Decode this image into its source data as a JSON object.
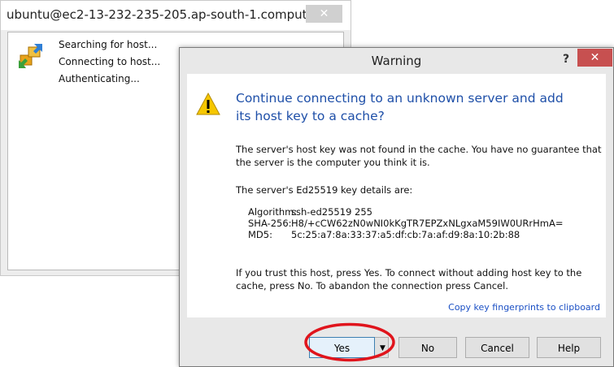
{
  "background_window": {
    "title": "ubuntu@ec2-13-232-235-205.ap-south-1.comput...",
    "close_glyph": "✕",
    "icon": "network-connect-icon",
    "status_lines": [
      "Searching for host...",
      "Connecting to host...",
      "Authenticating..."
    ]
  },
  "dialog": {
    "title": "Warning",
    "help_glyph": "?",
    "close_glyph": "✕",
    "icon": "warning-icon",
    "heading": "Continue connecting to an unknown server and add its host key to a cache?",
    "paragraph1": "The server's host key was not found in the cache. You have no guarantee that the server is the computer you think it is.",
    "paragraph2": "The server's Ed25519 key details are:",
    "key_details": [
      {
        "label": "Algorithm:",
        "value": "ssh-ed25519 255"
      },
      {
        "label": "SHA-256:",
        "value": "H8/+cCW62zN0wNI0kKgTR7EPZxNLgxaM59IW0URrHmA="
      },
      {
        "label": "MD5:",
        "value": "5c:25:a7:8a:33:37:a5:df:cb:7a:af:d9:8a:10:2b:88"
      }
    ],
    "paragraph3": "If you trust this host, press Yes. To connect without adding host key to the cache, press No. To abandon the connection press Cancel.",
    "copy_link": "Copy key fingerprints to clipboard",
    "buttons": {
      "yes": "Yes",
      "dropdown": "▼",
      "no": "No",
      "cancel": "Cancel",
      "help": "Help"
    }
  },
  "colors": {
    "heading_blue": "#1e4fa8",
    "link_blue": "#1a4fc4",
    "close_red": "#c75050",
    "annotation_red": "#e0141c"
  }
}
